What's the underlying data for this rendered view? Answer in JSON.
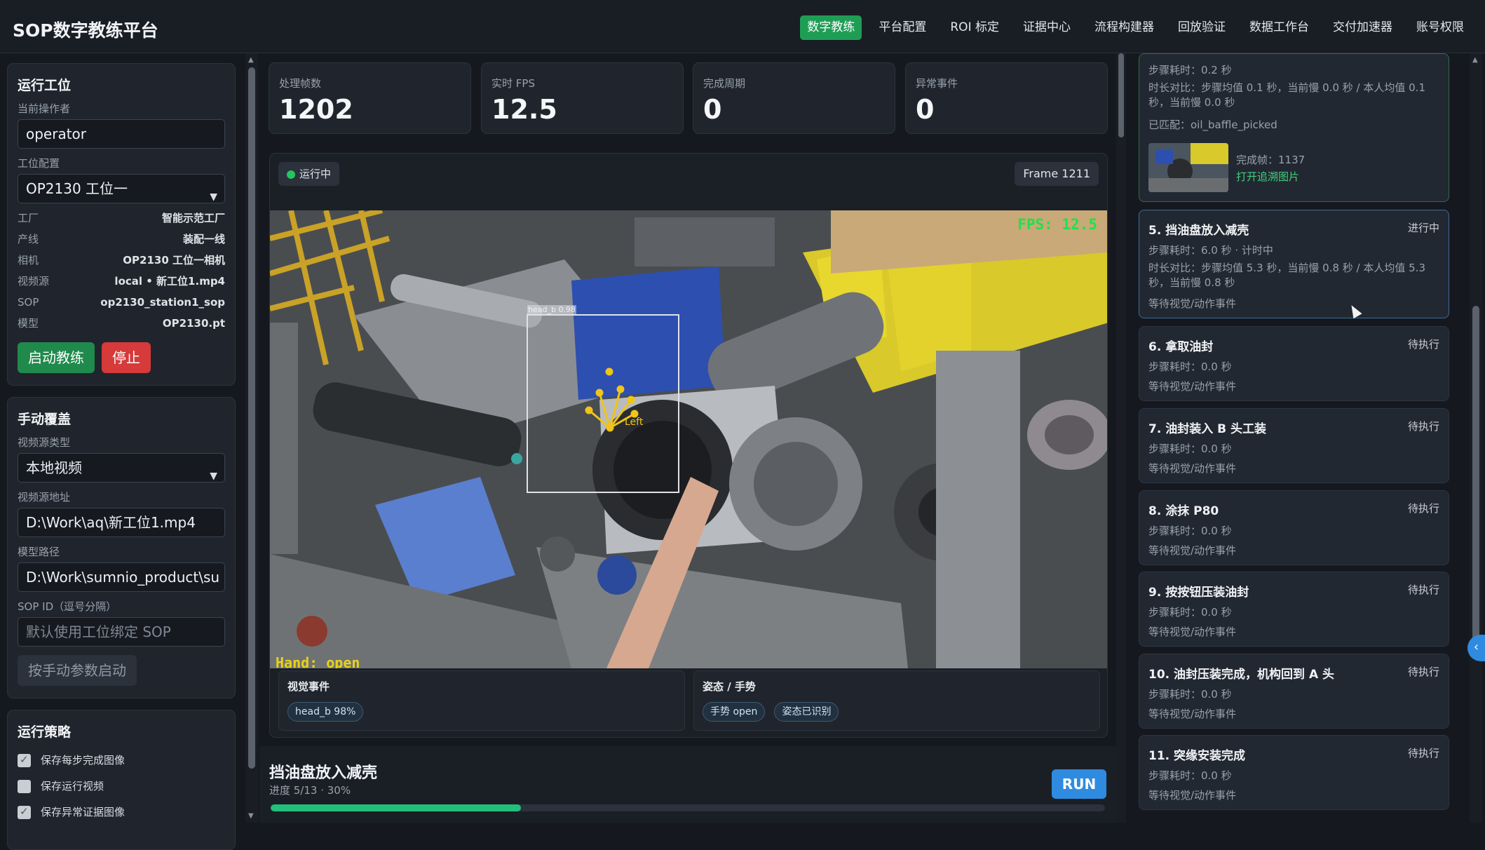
{
  "app": {
    "title": "SOP数字教练平台"
  },
  "nav": [
    {
      "label": "数字教练",
      "active": true
    },
    {
      "label": "平台配置"
    },
    {
      "label": "ROI 标定"
    },
    {
      "label": "证据中心"
    },
    {
      "label": "流程构建器"
    },
    {
      "label": "回放验证"
    },
    {
      "label": "数据工作台"
    },
    {
      "label": "交付加速器"
    },
    {
      "label": "账号权限"
    }
  ],
  "station": {
    "title": "运行工位",
    "operator_label": "当前操作者",
    "operator_value": "operator",
    "config_label": "工位配置",
    "config_value": "OP2130 工位一",
    "info": [
      {
        "k": "工厂",
        "v": "智能示范工厂"
      },
      {
        "k": "产线",
        "v": "装配一线"
      },
      {
        "k": "相机",
        "v": "OP2130 工位一相机"
      },
      {
        "k": "视频源",
        "v": "local • 新工位1.mp4"
      },
      {
        "k": "SOP",
        "v": "op2130_station1_sop"
      },
      {
        "k": "模型",
        "v": "OP2130.pt"
      }
    ],
    "start_label": "启动教练",
    "stop_label": "停止"
  },
  "manual": {
    "title": "手动覆盖",
    "source_type_label": "视频源类型",
    "source_type_value": "本地视频",
    "source_url_label": "视频源地址",
    "source_url_value": "D:\\Work\\aq\\新工位1.mp4",
    "model_path_label": "模型路径",
    "model_path_value": "D:\\Work\\sumnio_product\\su",
    "sop_id_label": "SOP ID（逗号分隔）",
    "sop_id_placeholder": "默认使用工位绑定 SOP",
    "start_manual_label": "按手动参数启动"
  },
  "policy": {
    "title": "运行策略",
    "options": [
      {
        "label": "保存每步完成图像",
        "checked": true
      },
      {
        "label": "保存运行视频",
        "checked": false
      },
      {
        "label": "保存异常证据图像",
        "checked": true
      }
    ]
  },
  "stats": [
    {
      "label": "处理帧数",
      "value": "1202"
    },
    {
      "label": "实时 FPS",
      "value": "12.5"
    },
    {
      "label": "完成周期",
      "value": "0"
    },
    {
      "label": "异常事件",
      "value": "0"
    }
  ],
  "video": {
    "status": "运行中",
    "frame": "Frame 1211",
    "fps_overlay": "FPS: 12.5",
    "hand_overlay": "Hand: open",
    "box_label": "head_b 0.98",
    "hand_label": "Left"
  },
  "events": {
    "visual_title": "视觉事件",
    "visual_chips": [
      "head_b 98%"
    ],
    "pose_title": "姿态 / 手势",
    "pose_chips": [
      "手势 open",
      "姿态已识别"
    ]
  },
  "current_step": {
    "name": "挡油盘放入减壳",
    "progress_text": "进度 5/13 · 30%",
    "progress": 0.3,
    "run_label": "RUN"
  },
  "prev_step": {
    "duration": "步骤耗时：0.2 秒",
    "compare": "时长对比：步骤均值 0.1 秒，当前慢 0.0 秒 / 本人均值 0.1 秒，当前慢 0.0 秒",
    "matched": "已匹配：oil_baffle_picked",
    "frame_label": "完成帧：1137",
    "open_link": "打开追溯图片"
  },
  "steps": [
    {
      "title": "5. 挡油盘放入减壳",
      "status": "进行中",
      "duration": "步骤耗时：6.0 秒 · 计时中",
      "compare": "时长对比：步骤均值 5.3 秒，当前慢 0.8 秒 / 本人均值 5.3 秒，当前慢 0.8 秒",
      "note": "等待视觉/动作事件"
    },
    {
      "title": "6. 拿取油封",
      "status": "待执行",
      "duration": "步骤耗时：0.0 秒",
      "note": "等待视觉/动作事件"
    },
    {
      "title": "7. 油封装入 B 头工装",
      "status": "待执行",
      "duration": "步骤耗时：0.0 秒",
      "note": "等待视觉/动作事件"
    },
    {
      "title": "8. 涂抹 P80",
      "status": "待执行",
      "duration": "步骤耗时：0.0 秒",
      "note": "等待视觉/动作事件"
    },
    {
      "title": "9. 按按钮压装油封",
      "status": "待执行",
      "duration": "步骤耗时：0.0 秒",
      "note": "等待视觉/动作事件"
    },
    {
      "title": "10. 油封压装完成，机构回到 A 头",
      "status": "待执行",
      "duration": "步骤耗时：0.0 秒",
      "note": "等待视觉/动作事件"
    },
    {
      "title": "11. 突缘安装完成",
      "status": "待执行",
      "duration": "步骤耗时：0.0 秒",
      "note": "等待视觉/动作事件"
    }
  ],
  "colors": {
    "accent": "#1f9d55",
    "danger": "#d63a3a",
    "run": "#2f8be0",
    "progress": "#22c07a"
  }
}
